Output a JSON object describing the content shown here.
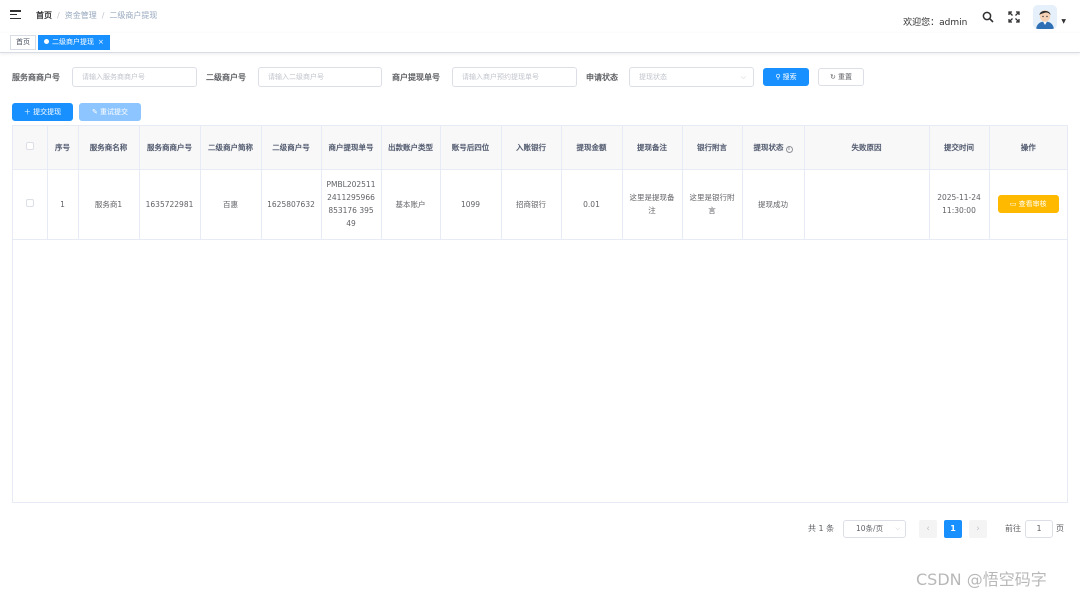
{
  "header": {
    "breadcrumb": [
      "首页",
      "资金管理",
      "二级商户提现"
    ],
    "welcome_label": "欢迎您：",
    "username": "admin"
  },
  "tags": {
    "home": "首页",
    "active": "二级商户提现",
    "close": "×"
  },
  "search": {
    "service_merchant_no_label": "服务商商户号",
    "service_merchant_no_placeholder": "请输入服务商商户号",
    "sub_merchant_no_label": "二级商户号",
    "sub_merchant_no_placeholder": "请输入二级商户号",
    "withdraw_no_label": "商户提现单号",
    "withdraw_no_placeholder": "请输入商户预约提现单号",
    "status_label": "申请状态",
    "status_placeholder": "提现状态",
    "search_button": "搜索",
    "reset_button": "重置"
  },
  "toolbar": {
    "submit_withdraw": "提交提现",
    "retry_submit": "重试提交"
  },
  "table": {
    "columns": [
      "序号",
      "服务商名称",
      "服务商商户号",
      "二级商户简称",
      "二级商户号",
      "商户提现单号",
      "出款账户类型",
      "账号后四位",
      "入账银行",
      "提现金额",
      "提现备注",
      "银行附言",
      "提现状态",
      "失败原因",
      "提交时间",
      "操作"
    ],
    "rows": [
      {
        "index": "1",
        "service_name": "服务商1",
        "service_merchant_no": "1635722981",
        "sub_merchant_short": "百惠",
        "sub_merchant_no": "1625807632",
        "withdraw_no": "PMBL2025112411295966853176 39549",
        "account_type": "基本账户",
        "account_last4": "1099",
        "bank": "招商银行",
        "amount": "0.01",
        "remark": "这里是提现备注",
        "bank_memo": "这里是银行附言",
        "status": "提现成功",
        "fail_reason": "",
        "submit_time": "2025-11-24 11:30:00",
        "action": "查看审核"
      }
    ]
  },
  "pagination": {
    "total": "共 1 条",
    "page_size": "10条/页",
    "current_page": "1",
    "goto_label": "前往",
    "goto_value": "1",
    "page_suffix": "页"
  },
  "watermark": "CSDN @悟空码字",
  "colors": {
    "primary": "#1890ff",
    "warning": "#ffba00"
  }
}
